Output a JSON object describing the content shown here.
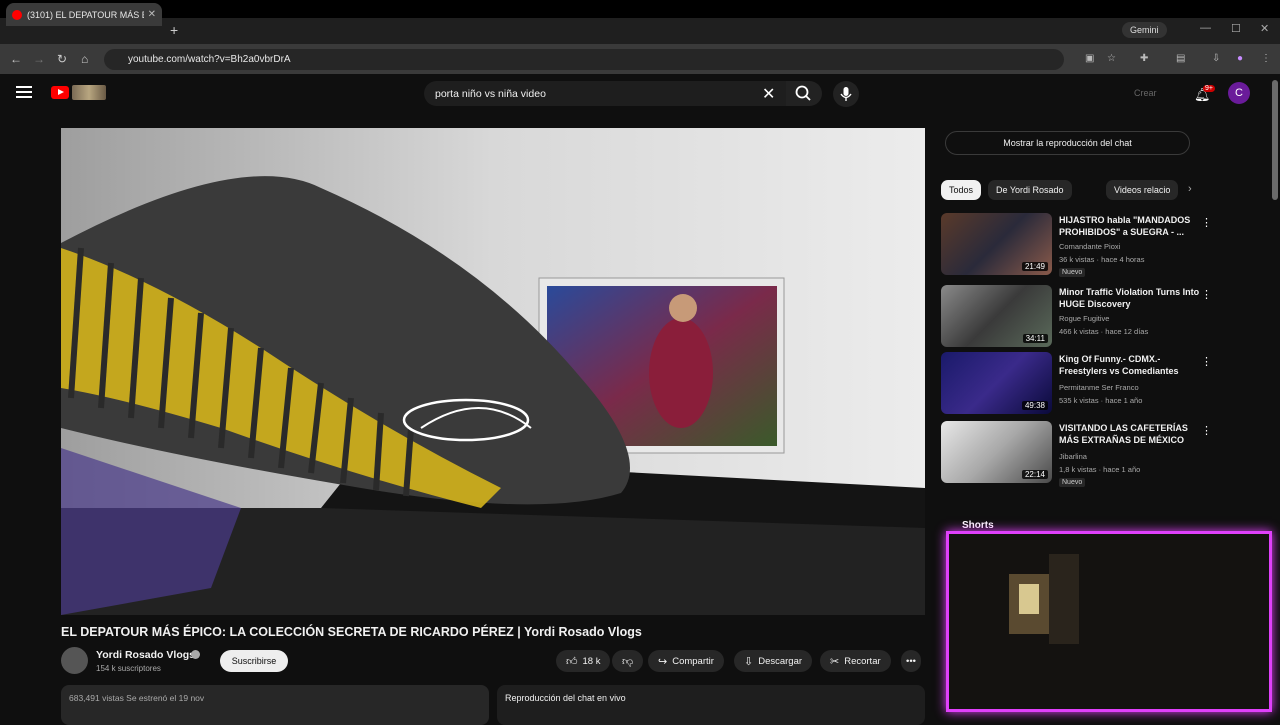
{
  "browser": {
    "tab_title": "(3101) EL DEPATOUR MÁS É",
    "new_tab": "+",
    "gemini_label": "Gemini",
    "url": "youtube.com/watch?v=Bh2a0vbrDrA"
  },
  "search": {
    "query": "porta niño vs niña video"
  },
  "header": {
    "create_label": "Crear",
    "notifications_count": "9+",
    "account_initial": "C"
  },
  "video": {
    "title": "EL DEPATOUR MÁS ÉPICO: LA COLECCIÓN SECRETA DE RICARDO PÉREZ | Yordi Rosado Vlogs",
    "channel_name": "Yordi Rosado Vlogs",
    "subscribers": "154 k suscriptores",
    "subscribe_label": "Suscribirse",
    "likes": "18 k",
    "share_label": "Compartir",
    "download_label": "Descargar",
    "clip_label": "Recortar",
    "views_info": "683,491 vistas  Se estrenó el 19 nov",
    "chat_replay_label": "Reproducción del chat en vivo"
  },
  "sidebar": {
    "show_chat_label": "Mostrar la reproducción del chat",
    "chips": [
      {
        "label": "Todos"
      },
      {
        "label": "De Yordi Rosado"
      },
      {
        "label": "Videos relacio"
      }
    ],
    "recommendations": [
      {
        "title": "HIJASTRO habla \"MANDADOS PROHIBIDOS\" a SUEGRA - ...",
        "channel": "Comandante Pioxi",
        "meta": "36 k vistas · hace 4 horas",
        "badge": "Nuevo",
        "duration": "21:49"
      },
      {
        "title": "Minor Traffic Violation Turns Into HUGE Discovery",
        "channel": "Rogue Fugitive",
        "meta": "466 k vistas · hace 12 días",
        "badge": "",
        "duration": "34:11"
      },
      {
        "title": "King Of Funny.- CDMX.- Freestylers vs Comediantes",
        "channel": "Permitanme Ser Franco",
        "meta": "535 k vistas · hace 1 año",
        "badge": "",
        "duration": "49:38"
      },
      {
        "title": "VISITANDO LAS CAFETERÍAS MÁS EXTRAÑAS DE MÉXICO",
        "channel": "Jibarlina",
        "meta": "1,8 k vistas · hace 1 año",
        "badge": "Nuevo",
        "duration": "22:14"
      }
    ],
    "shorts_label": "Shorts"
  }
}
